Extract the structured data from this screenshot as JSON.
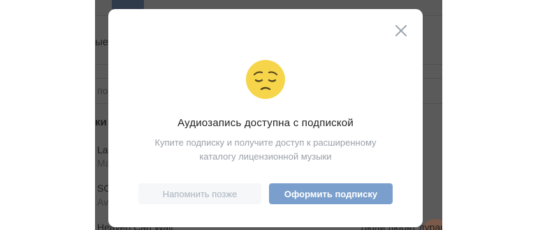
{
  "background": {
    "partial_labels": [
      "ые",
      "по",
      "ки",
      "Late",
      "Ma",
      "SOS",
      "Avi",
      "Heaven Can Wait",
      "Люди любят дураков"
    ]
  },
  "modal": {
    "close_icon": "close-icon",
    "emoji_icon": "pensive-face-icon",
    "title": "Аудиозапись доступна с подпиской",
    "description": "Купите подписку и получите доступ к расширенному каталогу лицензионной музыки",
    "buttons": {
      "remind_later": "Напомнить позже",
      "subscribe": "Оформить подписку"
    }
  },
  "colors": {
    "primary_button": "#7a9fcc",
    "secondary_button": "#f5f7f9",
    "emoji_face": "#f6d54a"
  }
}
